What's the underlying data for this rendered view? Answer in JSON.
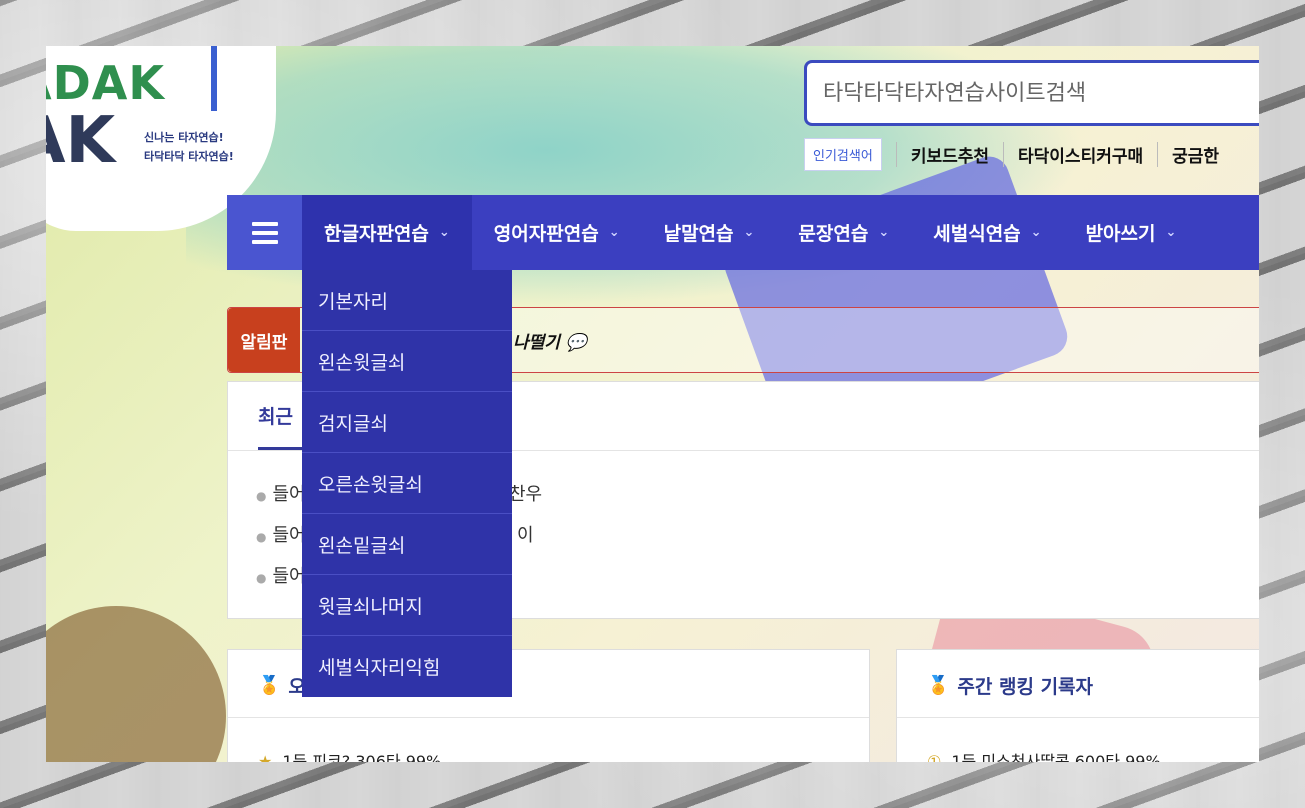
{
  "logo": {
    "line1": "ADAK",
    "line2": "AK",
    "tagline1": "신나는 타자연습!",
    "tagline2": "타닥타닥 타자연습!"
  },
  "search": {
    "placeholder": "타닥타닥타자연습사이트검색"
  },
  "popular": {
    "label": "인기검색어",
    "items": [
      "키보드추천",
      "타닥이스티커구매",
      "궁금한"
    ]
  },
  "nav": {
    "items": [
      "한글자판연습",
      "영어자판연습",
      "낱말연습",
      "문장연습",
      "세벌식연습",
      "받아쓰기"
    ],
    "chevron": "⌄"
  },
  "dropdown": {
    "items": [
      "기본자리",
      "왼손윗글쇠",
      "검지글쇠",
      "오른손윗글쇠",
      "왼손밑글쇠",
      "윗글쇠나머지",
      "세벌식자리익힘"
    ]
  },
  "notice": {
    "label": "알림판",
    "text": "나떨기"
  },
  "recent": {
    "tab": "최근",
    "rows": [
      {
        "prefix": "들어",
        "tail": "찬우"
      },
      {
        "prefix": "들어",
        "tail": "이"
      },
      {
        "prefix": "들어",
        "tail": ""
      }
    ]
  },
  "ranking": {
    "left_title": "오",
    "right_title": "주간 랭킹 기록자",
    "left_row": "1등 피코? 306타 99%",
    "right_row": "1등 미소천사딸콩 600타 99%"
  },
  "colors": {
    "nav_bg": "#3b3fc0",
    "dropdown_bg": "#2f33a8",
    "notice_label": "#c8401e",
    "accent": "#3b4bbf"
  }
}
